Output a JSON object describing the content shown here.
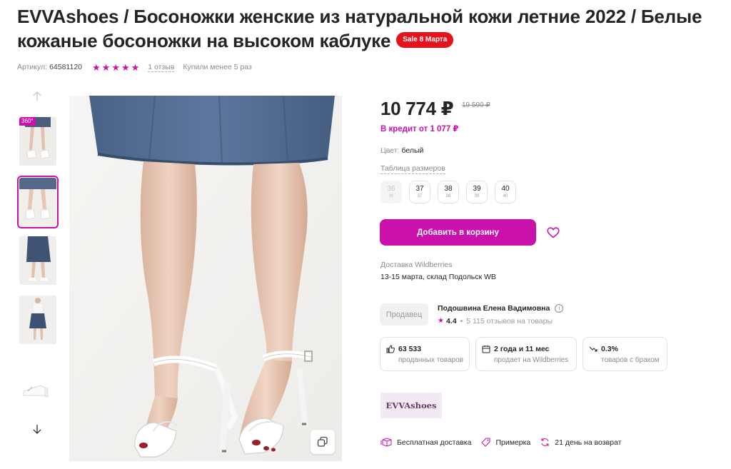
{
  "product": {
    "title": "EVVAshoes / Босоножки женские из натуральной кожи летние 2022 / Белые кожаные босоножки на высоком каблуке",
    "sale_badge": "Sale 8 Марта",
    "article_label": "Артикул:",
    "article_value": "64581120",
    "rating_stars": 5,
    "reviews_link": "1 отзыв",
    "bought_text": "Купили менее 5 раз"
  },
  "gallery": {
    "badge_360": "360°",
    "active_index": 1,
    "thumbnail_count": 5
  },
  "pricing": {
    "price": "10 774 ₽",
    "old_price": "19 590 ₽",
    "credit": "В кредит от 1 077 ₽"
  },
  "options": {
    "color_label": "Цвет:",
    "color_value": "белый",
    "size_table_link": "Таблица размеров",
    "sizes": [
      {
        "main": "36",
        "sub": "36",
        "available": false
      },
      {
        "main": "37",
        "sub": "37",
        "available": true
      },
      {
        "main": "38",
        "sub": "38",
        "available": true
      },
      {
        "main": "39",
        "sub": "39",
        "available": true
      },
      {
        "main": "40",
        "sub": "40",
        "available": true
      }
    ]
  },
  "actions": {
    "add_to_cart": "Добавить в корзину"
  },
  "delivery": {
    "label": "Доставка Wildberries",
    "value": "13-15 марта, склад Подольск WB"
  },
  "seller": {
    "badge": "Продавец",
    "name": "Подошвина Елена Вадимовна",
    "info": "i",
    "rating": "4.4",
    "reviews": "5 115 отзывов на товары"
  },
  "stats": [
    {
      "value": "63 533",
      "label": "проданных товаров"
    },
    {
      "value": "2 года и 11 мес",
      "label": "продает на Wildberries"
    },
    {
      "value": "0.3%",
      "label": "товаров с браком"
    }
  ],
  "brand": {
    "logo_text": "EVVAshoes"
  },
  "perks": [
    {
      "label": "Бесплатная доставка"
    },
    {
      "label": "Примерка"
    },
    {
      "label": "21 день на возврат"
    }
  ],
  "colors": {
    "accent": "#cb11ab",
    "sale": "#e3141b"
  }
}
